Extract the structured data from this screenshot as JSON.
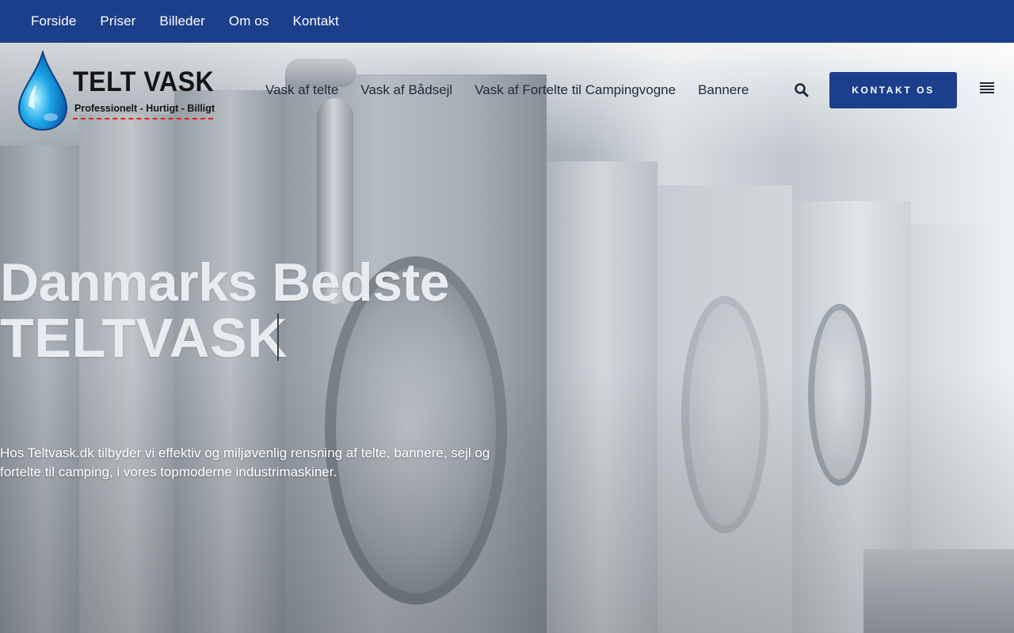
{
  "topbar": {
    "links": [
      "Forside",
      "Priser",
      "Billeder",
      "Om os",
      "Kontakt"
    ]
  },
  "logo": {
    "title": "TELT VASK",
    "tagline": "Professionelt - Hurtigt - Billigt"
  },
  "mainnav": {
    "links": [
      "Vask af telte",
      "Vask af Bådsejl",
      "Vask af Fortelte til Campingvogne",
      "Bannere"
    ]
  },
  "header": {
    "cta_label": "KONTAKT OS",
    "search_icon": "search-icon",
    "menu_icon": "menu-icon"
  },
  "hero": {
    "title_line1": "Danmarks Bedste",
    "title_line2": "TELTVASK",
    "text": "Hos Teltvask.dk tilbyder vi effektiv og miljøvenlig rensning af telte, bannere, sejl og fortelte til camping, i vores topmoderne industrimaskiner."
  },
  "colors": {
    "brand_blue": "#1c3f8c",
    "nav_text": "#1e2b3c",
    "logo_tag_border": "#e2231a"
  }
}
